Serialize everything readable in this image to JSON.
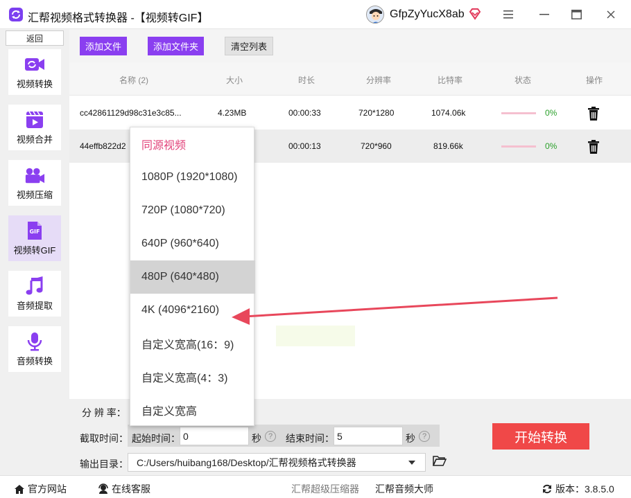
{
  "window": {
    "title": "汇帮视频格式转换器 -【视频转GIF】",
    "username": "GfpZyYucX8ab"
  },
  "sidebar": {
    "back_label": "返回",
    "items": [
      {
        "label": "视频转换",
        "icon": "video-convert-icon"
      },
      {
        "label": "视频合并",
        "icon": "video-merge-icon"
      },
      {
        "label": "视频压缩",
        "icon": "video-compress-icon"
      },
      {
        "label": "视频转GIF",
        "icon": "gif-icon"
      },
      {
        "label": "音频提取",
        "icon": "music-note-icon"
      },
      {
        "label": "音频转换",
        "icon": "microphone-icon"
      }
    ]
  },
  "toolbar": {
    "add_file": "添加文件",
    "add_folder": "添加文件夹",
    "clear_list": "清空列表"
  },
  "table": {
    "headers": [
      "名称 (2)",
      "大小",
      "时长",
      "分辨率",
      "比特率",
      "状态",
      "操作"
    ],
    "rows": [
      {
        "name": "cc42861129d98c31e3c85...",
        "size": "4.23MB",
        "duration": "00:00:33",
        "resolution": "720*1280",
        "bitrate": "1074.06k",
        "progress": "0%"
      },
      {
        "name": "44effb822d2",
        "size": "",
        "duration": "00:00:13",
        "resolution": "720*960",
        "bitrate": "819.66k",
        "progress": "0%"
      }
    ]
  },
  "dropdown": {
    "options": [
      "同源视频",
      "1080P (1920*1080)",
      "720P (1080*720)",
      "640P (960*640)",
      "480P (640*480)",
      "4K (4096*2160)",
      "自定义宽高(16：9)",
      "自定义宽高(4：3)",
      "自定义宽高"
    ],
    "selected_index": 0,
    "hover_index": 4
  },
  "settings": {
    "resolution_label": "分 辨 率：",
    "clip_label": "截取时间：",
    "start_label": "起始时间：",
    "start_value": "0",
    "start_unit": "秒",
    "end_label": "结束时间：",
    "end_value": "5",
    "end_unit": "秒",
    "output_label": "输出目录：",
    "output_path": "C:/Users/huibang168/Desktop/汇帮视频格式转换器",
    "start_button": "开始转换"
  },
  "footer": {
    "website": "官方网站",
    "support": "在线客服",
    "link1": "汇帮超级压缩器",
    "link2": "汇帮音频大师",
    "version": "版本：3.8.5.0"
  },
  "colors": {
    "accent_purple": "#8a3ff0",
    "start_red": "#f04848",
    "selected_pink": "#e2437a",
    "progress_green": "#2aa02a"
  }
}
